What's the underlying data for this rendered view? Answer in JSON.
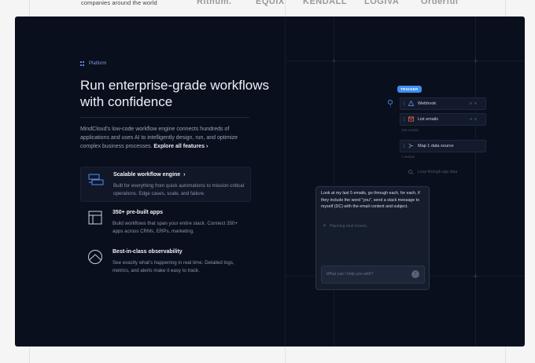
{
  "top": {
    "tagline": "companies around the world",
    "logos": [
      "Rithum.",
      "EQUIX",
      "KENDALL",
      "LOGIVA",
      "Orderful"
    ]
  },
  "section": {
    "eyebrow": "Platform",
    "headline": "Run enterprise-grade workflows with confidence",
    "description": "MindCloud's low-code workflow engine connects hundreds of applications and uses AI to intelligently design, run, and optimize complex business processes.",
    "explore_link": "Explore all features",
    "explore_chevron": "›"
  },
  "features": [
    {
      "title": "Scalable workflow engine",
      "chevron": "›",
      "description": "Built for everything from quick automations to mission-critical operations. Edge cases, scale, and failure.",
      "icon": "stack-icon",
      "active": true
    },
    {
      "title": "350+ pre-built apps",
      "description": "Build workflows that span your entire stack. Connect 350+ apps across CRMs, ERPs, marketing.",
      "icon": "apps-icon",
      "active": false
    },
    {
      "title": "Best-in-class observability",
      "description": "See exactly what's happening in real time. Detailed logs, metrics, and alerts make it easy to track.",
      "icon": "mountain-icon",
      "active": false
    }
  ],
  "workflow": {
    "trigger_badge": "TRIGGER",
    "nodes": [
      {
        "label": "Webhook",
        "icon": "webhook-icon"
      },
      {
        "label": "List emails",
        "icon": "gmail-icon"
      },
      {
        "label": "Map 1 data source",
        "icon": "map-icon"
      }
    ],
    "results_label": "125 results",
    "events_label": "1 events",
    "loop_label": "Loop through app data"
  },
  "chat": {
    "message": "Look at my last 5 emails, go through each, for each, if they include the word \"you\", send a slack message to myself (DC) with the email content and subject.",
    "thinking": "Planning next moves...",
    "input_placeholder": "What can I help you with?",
    "send_icon": "arrow-up-icon"
  },
  "colors": {
    "panel_bg": "#0a0f1d",
    "accent": "#3c8ef0",
    "icon_accent": "#4a8ff0"
  }
}
